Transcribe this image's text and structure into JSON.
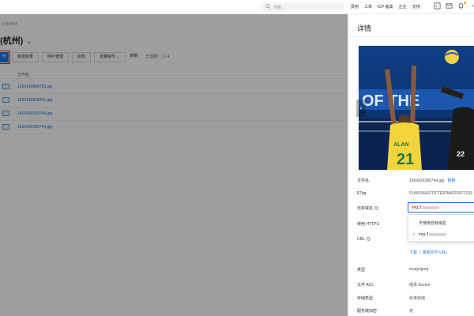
{
  "topbar": {
    "search_placeholder": "搜索...",
    "nav": [
      "费用",
      "工单",
      "ICP 备案",
      "企业",
      "支持"
    ],
    "icons": [
      "terminal-icon",
      "mail-icon",
      "bell-icon",
      "more-icon"
    ]
  },
  "main": {
    "breadcrumb": "对象存储",
    "bucket_title": "(杭州)",
    "toolbar": {
      "upload_label": "传",
      "new_folder_label": "新建目录",
      "fragment_label": "碎片管理",
      "authorize_label": "授权",
      "batch_label": "批量操作",
      "refresh_label": "刷新",
      "selected_label": "已选择：1 / 4"
    },
    "file_column_header": "文件名",
    "files": [
      "1663418884793.jpg",
      "1663418818451.jpg",
      "1663420268749.jpg",
      "1663420286744.jpg"
    ]
  },
  "drawer": {
    "title": "详情",
    "props": {
      "filename_label": "文件名",
      "filename_value": "1663420286744.jpg",
      "copy_label": "复制",
      "etag_label": "ETag",
      "etag_value": "51A5096A37DC7E87BA2F6872193",
      "domain_label": "自有域名",
      "domain_value": "img.3",
      "https_label": "使用 HTTPS",
      "url_label": "URL",
      "url_value": "https://img.3",
      "download_label": "下载",
      "copy_url_label": "复制文件 URL",
      "type_label": "类型",
      "type_value": "image/jpeg",
      "acl_label": "文件 ACL",
      "acl_value": "继承 Bucket",
      "storage_label": "存储类型",
      "storage_value": "标准存储",
      "encrypt_label": "服务端加密",
      "encrypt_value": "无"
    },
    "dropdown": {
      "option_none": "不使用自有域名",
      "option_selected": "img.3"
    }
  },
  "colors": {
    "accent": "#1a73e8",
    "highlight_border": "#e02020",
    "overlay": "rgba(0,0,0,0.38)"
  }
}
